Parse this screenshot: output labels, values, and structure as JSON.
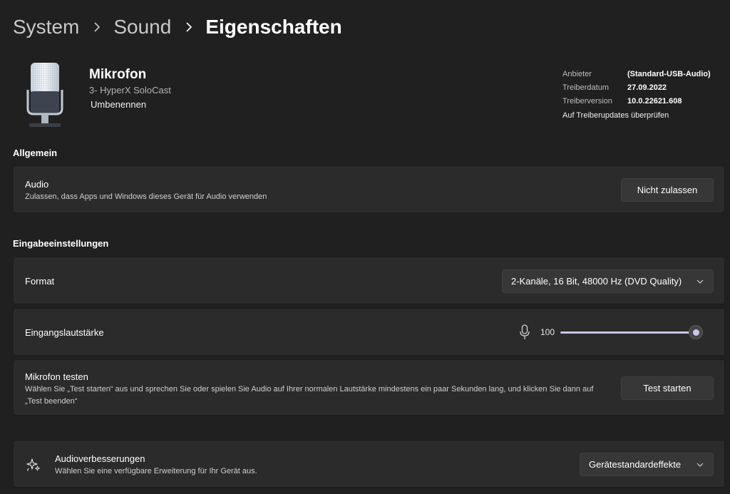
{
  "breadcrumb": {
    "items": [
      "System",
      "Sound"
    ],
    "current": "Eigenschaften"
  },
  "device": {
    "name": "Mikrofon",
    "subtitle": "3- HyperX SoloCast",
    "rename_label": "Umbenennen",
    "icon": "microphone-icon"
  },
  "properties": {
    "rows": [
      {
        "key": "Anbieter",
        "value": "(Standard-USB-Audio)"
      },
      {
        "key": "Treiberdatum",
        "value": "27.09.2022"
      },
      {
        "key": "Treiberversion",
        "value": "10.0.22621.608"
      }
    ],
    "update_link": "Auf Treiberupdates überprüfen"
  },
  "general": {
    "section_title": "Allgemein",
    "audio": {
      "title": "Audio",
      "description": "Zulassen, dass Apps und Windows dieses Gerät für Audio verwenden",
      "button": "Nicht zulassen"
    }
  },
  "input": {
    "section_title": "Eingabeeinstellungen",
    "format": {
      "title": "Format",
      "selected": "2-Kanäle, 16 Bit, 48000 Hz (DVD Quality)"
    },
    "volume": {
      "title": "Eingangslautstärke",
      "value": "100",
      "level_percent": 100
    },
    "test": {
      "title": "Mikrofon testen",
      "description": "Wählen Sie „Test starten“ aus und sprechen Sie oder spielen Sie Audio auf Ihrer normalen Lautstärke mindestens ein paar Sekunden lang, und klicken Sie dann auf „Test beenden“",
      "button": "Test starten"
    }
  },
  "enhancements": {
    "title": "Audioverbesserungen",
    "description": "Wählen Sie eine verfügbare Erweiterung für Ihr Gerät aus.",
    "selected": "Gerätestandardeffekte",
    "icon": "sparkle-icon"
  },
  "colors": {
    "background": "#202020",
    "card": "#2b2b2b",
    "accent": "#cfc3ee"
  }
}
